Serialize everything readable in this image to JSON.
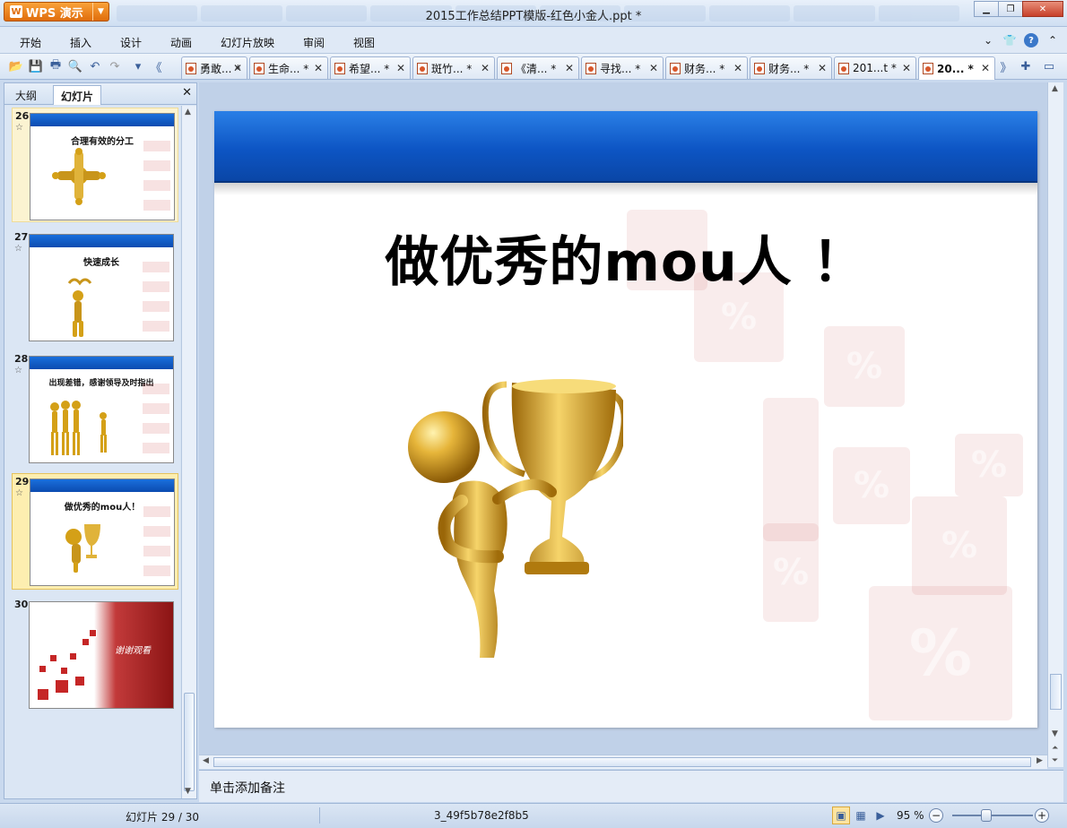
{
  "app": {
    "button_label": "WPS 演示",
    "window_title": "2015工作总结PPT模版-红色小金人.ppt *"
  },
  "menu": [
    "开始",
    "插入",
    "设计",
    "动画",
    "幻灯片放映",
    "审阅",
    "视图"
  ],
  "doc_tabs": [
    "勇敢... *",
    "生命... *",
    "希望... *",
    "斑竹... *",
    "《清... *",
    "寻找... *",
    "财务... *",
    "财务... *",
    "201...t *",
    "20... *"
  ],
  "left_panel": {
    "tabs": [
      "大纲",
      "幻灯片"
    ],
    "active_tab": "幻灯片",
    "thumbnails": [
      {
        "num": "26",
        "title": "合理有效的分工"
      },
      {
        "num": "27",
        "title": "快速成长"
      },
      {
        "num": "28",
        "title": "出现差错，感谢领导及时指出"
      },
      {
        "num": "29",
        "title": "做优秀的mou人！"
      },
      {
        "num": "30",
        "title": "谢谢观看"
      }
    ],
    "selected": "29"
  },
  "slide": {
    "title": "做优秀的mou人 ！",
    "cube_glyph": "%"
  },
  "notes_placeholder": "单击添加备注",
  "status": {
    "slide_info": "幻灯片 29 / 30",
    "doc_id": "3_49f5b78e2f8b5",
    "zoom": "95 %"
  },
  "colors": {
    "accent_blue": "#0d55c4",
    "wps_orange": "#e06d0b",
    "gold": "#d4a017",
    "cube_red": "#c52626"
  }
}
